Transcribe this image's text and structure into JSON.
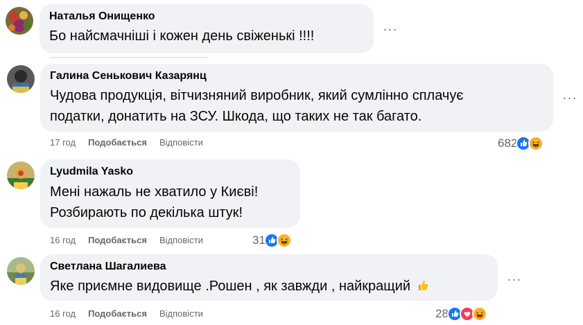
{
  "comments": [
    {
      "author": "Наталья Онищенко",
      "lines": [
        "Бо найсмачніші і кожен день свіженькі !!!!"
      ],
      "more": "···"
    },
    {
      "author": "Галина Сенькович Казарянц",
      "lines": [
        "Чудова продукція, вітчизняний виробник, який сумлінно сплачує",
        "податки, донатить на ЗСУ. Шкода, що таких не так багато."
      ],
      "more": "···",
      "time": "17 год",
      "like": "Подобається",
      "reply": "Відповісти",
      "reaction_count": "682",
      "reactions": [
        "like",
        "haha"
      ]
    },
    {
      "author": "Lyudmila Yasko",
      "lines": [
        "Мені нажаль не хватило у Києві!",
        "Розбирають по декілька штук!"
      ],
      "time": "16 год",
      "like": "Подобається",
      "reply": "Відповісти",
      "reaction_count": "31",
      "reactions": [
        "like",
        "haha"
      ]
    },
    {
      "author": "Светлана Шагалиева",
      "lines": [
        "Яке приємне видовище .Рошен , як завжди , найкращий"
      ],
      "emoji": "thumbs-up",
      "more": "···",
      "time": "16 год",
      "like": "Подобається",
      "reply": "Відповісти",
      "reaction_count": "28",
      "reactions": [
        "like",
        "love",
        "haha"
      ]
    }
  ],
  "colors": {
    "bubble": "#f0f2f5",
    "secondary_text": "#65676b",
    "like_blue": "#1877f2",
    "love_red": "#f33e58",
    "haha_yellow": "#f7b125"
  }
}
